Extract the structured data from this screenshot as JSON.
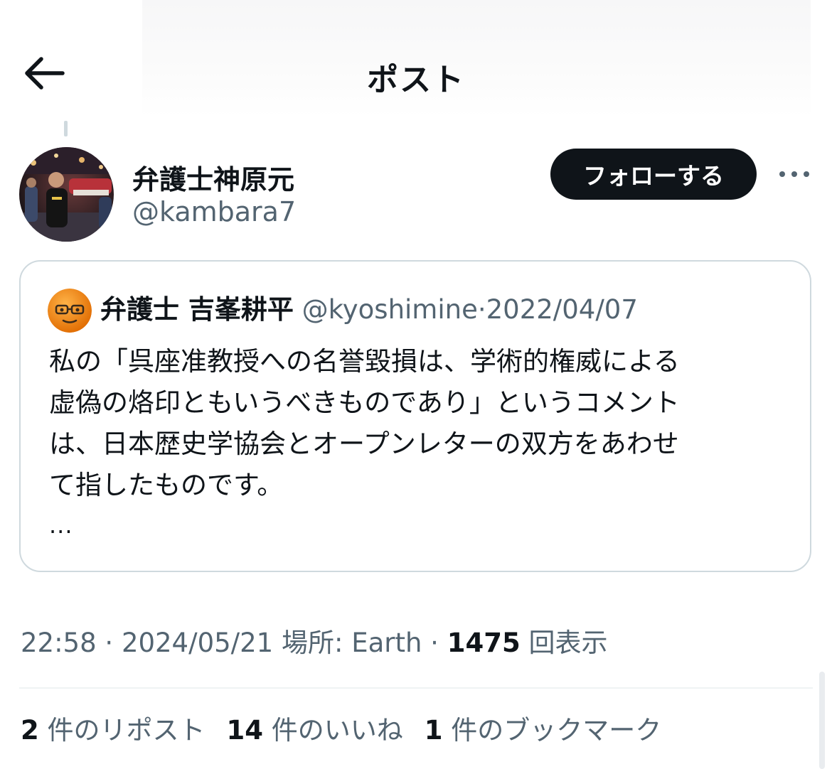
{
  "header": {
    "title": "ポスト",
    "back_icon": "arrow-left-icon"
  },
  "author": {
    "name": "弁護士神原元",
    "handle": "@kambara7",
    "follow_label": "フォローする",
    "more_icon": "more-horizontal-icon"
  },
  "quote": {
    "name": "弁護士 吉峯耕平",
    "handle": "@kyoshimine",
    "separator": "·",
    "date": "2022/04/07",
    "lines": [
      "私の「呉座准教授への名誉毀損は、学術的権威による",
      "虚偽の烙印ともいうべきものであり」というコメント",
      "は、日本歴史学協会とオープンレターの双方をあわせ",
      "て指したものです。"
    ],
    "ellipsis": "..."
  },
  "meta": {
    "time": "22:58",
    "sep1": " · ",
    "date": "2024/05/21",
    "location": " 場所: Earth",
    "sep2": " · ",
    "views": "1475",
    "views_label": " 回表示"
  },
  "stats": [
    {
      "count": "2",
      "label": " 件のリポスト"
    },
    {
      "count": "14",
      "label": " 件のいいね"
    },
    {
      "count": "1",
      "label": " 件のブックマーク"
    }
  ],
  "colors": {
    "text_primary": "#0f1419",
    "text_secondary": "#536471",
    "border": "#cfd9de",
    "follow_bg": "#0f1419"
  }
}
